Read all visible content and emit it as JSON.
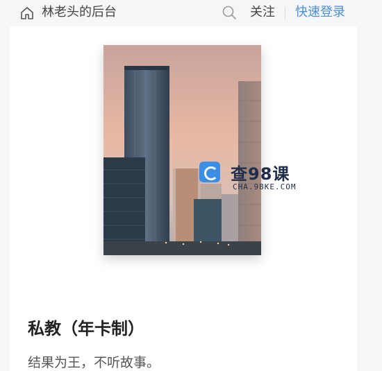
{
  "header": {
    "site_title": "林老头的后台",
    "follow_label": "关注",
    "login_label": "快速登录",
    "icons": [
      "home-icon",
      "search-icon"
    ]
  },
  "watermark": {
    "text": "查98课",
    "sub": "CHA.98KE.COM"
  },
  "product": {
    "title": "私教（年卡制）",
    "description": "结果为王，不听故事。"
  },
  "colors": {
    "accent": "#4a8fd4",
    "background": "#f5f6f8",
    "card": "#ffffff"
  }
}
